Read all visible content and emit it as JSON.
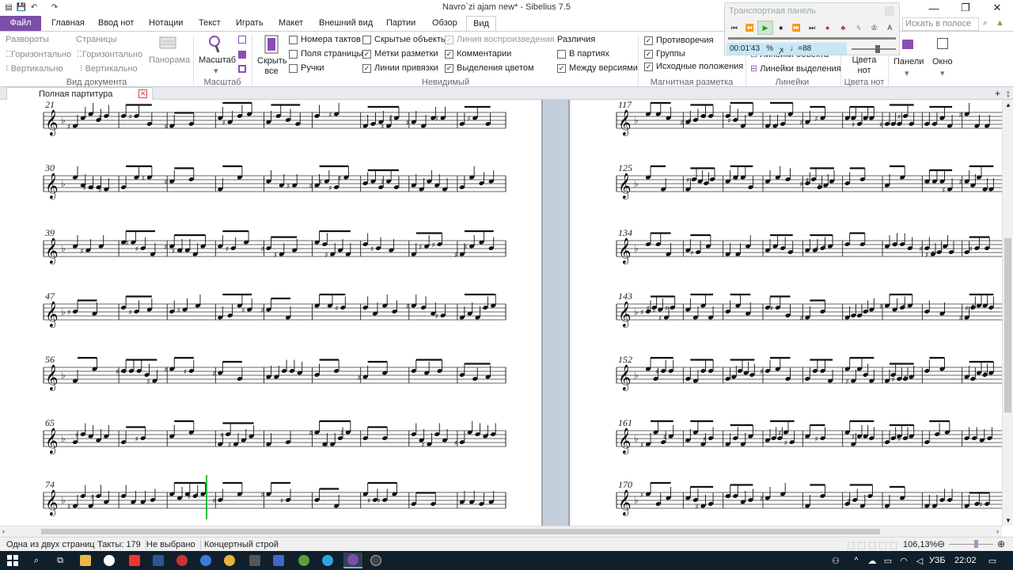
{
  "title": "Navro`zi ajam new* - Sibelius 7.5",
  "qat": {
    "save_glyph": "💾",
    "undo_glyph": "↶",
    "redo_glyph": "↷"
  },
  "window": {
    "minimize": "—",
    "restore": "❐",
    "close": "✕"
  },
  "transport": {
    "title": "Транспортная панель",
    "time": "00:01'43",
    "time_sig": "%",
    "key_sig": "ꭗ",
    "tempo": "♩=88",
    "buttons": [
      "⏮",
      "⏪",
      "▶",
      "⏹",
      "⏩",
      "⏭",
      "●",
      "♣",
      "ϟ",
      "♔",
      "A"
    ]
  },
  "search": {
    "placeholder": "Искать в полосе"
  },
  "tabs": [
    "Файл",
    "Главная",
    "Ввод нот",
    "Нотации",
    "Текст",
    "Играть",
    "Макет",
    "Внешний вид",
    "Партии",
    "Обзор",
    "Вид"
  ],
  "active_tab": "Вид",
  "ribbon": {
    "spreads": "Развороты",
    "pages": "Страницы",
    "horizontally": "Горизонтально",
    "vertically": "Вертикально",
    "panorama": "Панорама",
    "zoom": "Масштаб",
    "hide_all": "Скрыть все",
    "measure_numbers": "Номера тактов",
    "page_margins": "Поля страницы",
    "handles": "Ручки",
    "hidden_objects": "Скрытые объекты",
    "layout_marks": "Метки разметки",
    "attachment_lines": "Линии привязки",
    "playback_line": "Линия воспроизведения",
    "comments": "Комментарии",
    "selection_colors": "Выделения цветом",
    "differences": "Различия",
    "in_parts": "В партиях",
    "between_versions": "Между версиями",
    "collisions": "Противоречия",
    "groups": "Группы",
    "original_positions": "Исходные положения",
    "object_rulers": "Линейки объекта",
    "selection_rulers": "Линейки выделения",
    "note_colors": "Цвета нот",
    "panels": "Панели",
    "window": "Окно",
    "groups_labels": {
      "document_view": "Вид документа",
      "zoom": "Масштаб",
      "invisibles": "Невидимый",
      "magnetic_layout": "Магнитная разметка",
      "rulers": "Линейки",
      "note_colors": "Цвета нот"
    }
  },
  "document_tab": "Полная партитура",
  "score": {
    "left_system_numbers": [
      "21",
      "30",
      "39",
      "47",
      "56",
      "65",
      "74"
    ],
    "right_system_numbers": [
      "117",
      "125",
      "134",
      "143",
      "152",
      "161",
      "170"
    ]
  },
  "status": {
    "page_info": "Одна из двух страниц",
    "bars": "Такты: 179",
    "selection": "Не выбрано",
    "pitch": "Концертный строй",
    "zoom": "106,13%"
  },
  "taskbar": {
    "language": "УЗБ",
    "time": "22:02"
  }
}
